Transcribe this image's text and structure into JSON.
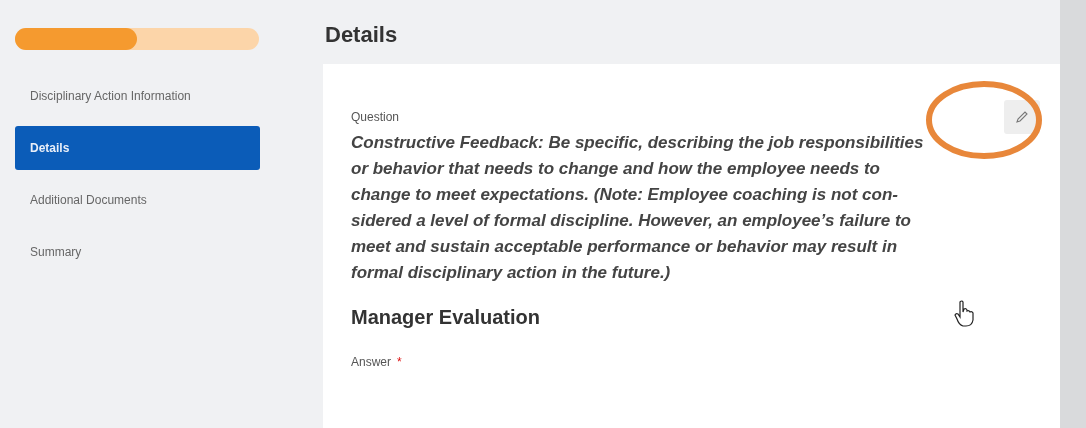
{
  "progress": {
    "level": 0.5
  },
  "sidebar": {
    "items": [
      {
        "label": "Disciplinary Action Information",
        "selected": false
      },
      {
        "label": "Details",
        "selected": true
      },
      {
        "label": "Additional Documents",
        "selected": false
      },
      {
        "label": "Summary",
        "selected": false
      }
    ]
  },
  "page": {
    "title": "Details"
  },
  "question": {
    "label": "Question",
    "text": "Constructive Feedback: Be specific, describing the job responsibilities\nor behavior that needs to change and how the employee needs to\nchange to meet expectations. (Note:  Employee coaching is not con-\nsidered a level of formal discipline. However, an employee’s failure to\nmeet and sustain acceptable performance or behavior may result in\nformal disciplinary action in the future.)"
  },
  "section": {
    "title": "Manager Evaluation"
  },
  "answer": {
    "label": "Answer",
    "required": true,
    "required_mark": "*"
  }
}
